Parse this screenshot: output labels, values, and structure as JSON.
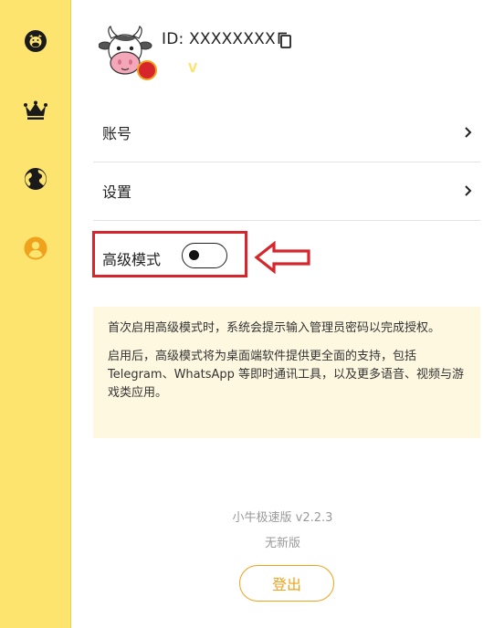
{
  "sidebar": {
    "items": [
      {
        "icon": "cow-icon",
        "active": false
      },
      {
        "icon": "crown-icon",
        "active": false
      },
      {
        "icon": "globe-icon",
        "active": false
      },
      {
        "icon": "user-icon",
        "active": true
      }
    ],
    "active_color": "#f0a21c"
  },
  "profile": {
    "id_text": "ID: XXXXXXXX",
    "badge": "V"
  },
  "menu": {
    "account_label": "账号",
    "settings_label": "设置"
  },
  "advanced": {
    "label": "高级模式",
    "enabled": false
  },
  "info": {
    "paragraph1": "首次启用高级模式时，系统会提示输入管理员密码以完成授权。",
    "paragraph2": "启用后，高级模式将为桌面端软件提供更全面的支持，包括 Telegram、WhatsApp 等即时通讯工具，以及更多语音、视频与游戏类应用。"
  },
  "footer": {
    "version": "小牛极速版 v2.2.3",
    "update_status": "无新版",
    "logout_label": "登出"
  },
  "colors": {
    "sidebar_bg": "#fde46f",
    "accent": "#f0a21c",
    "highlight_red": "#d6262c",
    "info_bg": "#fff8e1"
  }
}
